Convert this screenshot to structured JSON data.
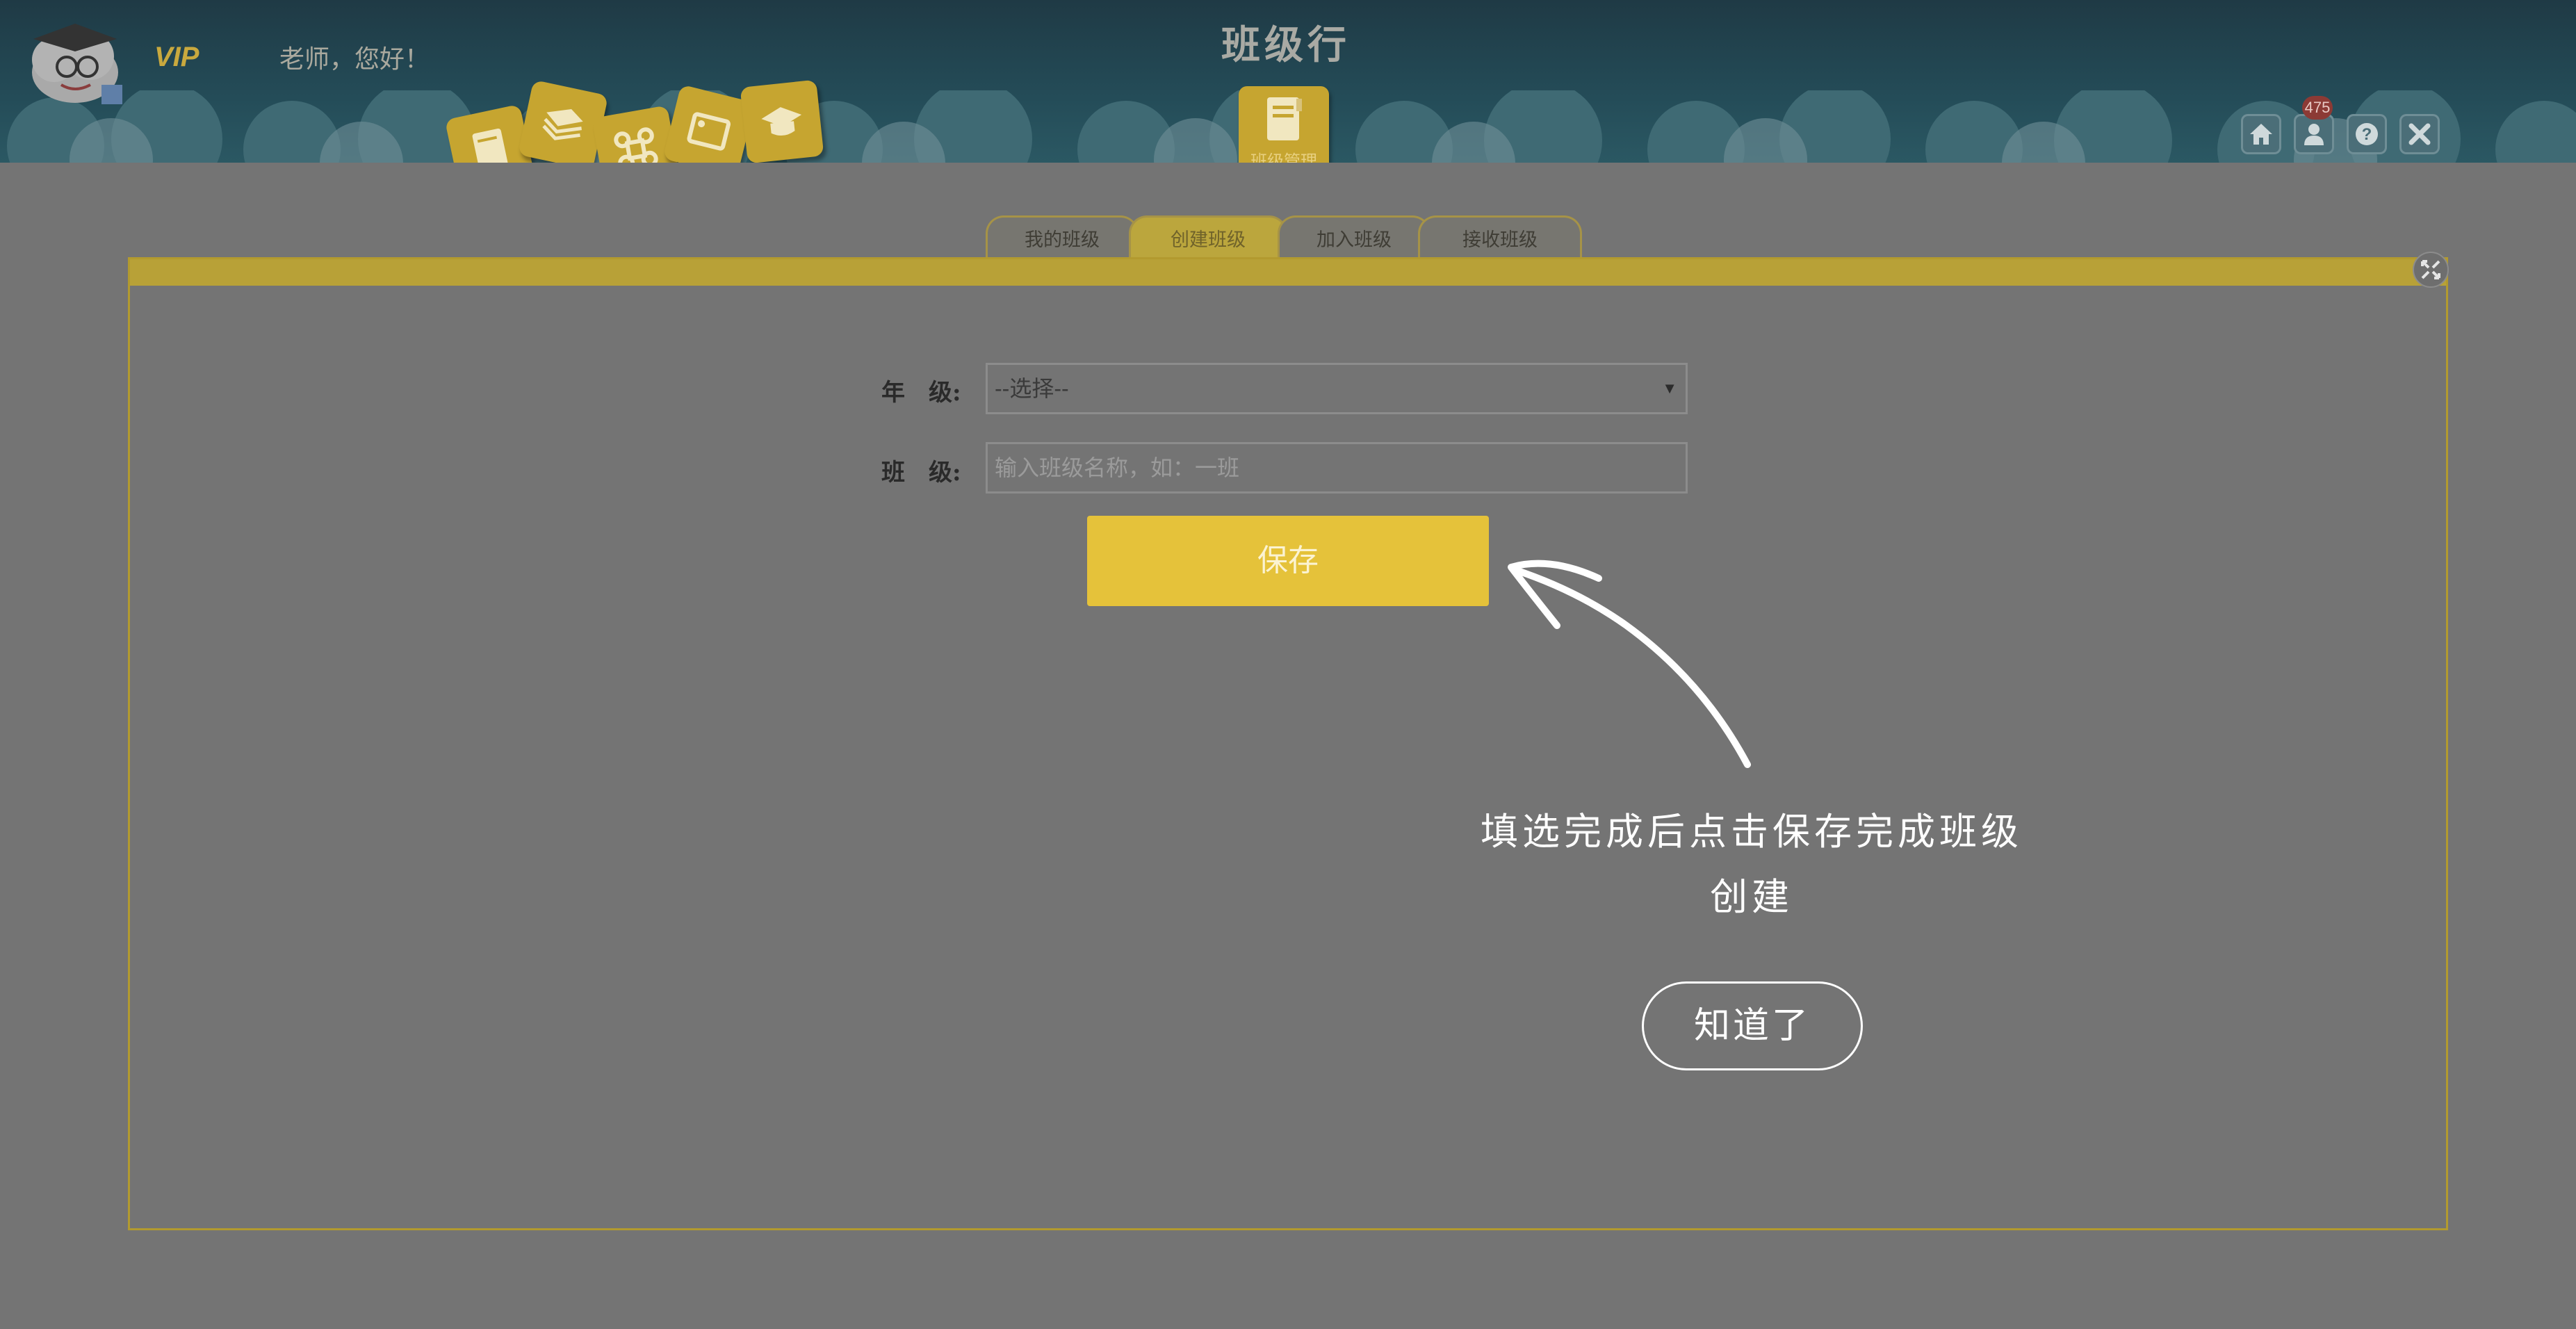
{
  "header": {
    "vip": "VIP",
    "greeting": "老师，您好！",
    "title": "班级行",
    "center_tile_label": "班级管理",
    "tiles": [
      "notebook-icon",
      "books-icon",
      "command-icon",
      "tag-icon",
      "cap-icon"
    ],
    "badge_count": "475"
  },
  "tabs": [
    {
      "label": "我的班级",
      "active": false
    },
    {
      "label": "创建班级",
      "active": true
    },
    {
      "label": "加入班级",
      "active": false
    },
    {
      "label": "接收班级",
      "active": false
    }
  ],
  "form": {
    "grade_label": "年　级:",
    "grade_value": "--选择--",
    "class_label": "班　级:",
    "class_placeholder": "输入班级名称，如：一班",
    "save_label": "保存"
  },
  "coach": {
    "hint_line1": "填选完成后点击保存完成班级",
    "hint_line2": "创建",
    "ok_label": "知道了"
  },
  "colors": {
    "accent": "#e5c23a",
    "header": "#244c58",
    "overlay": "#747474"
  }
}
